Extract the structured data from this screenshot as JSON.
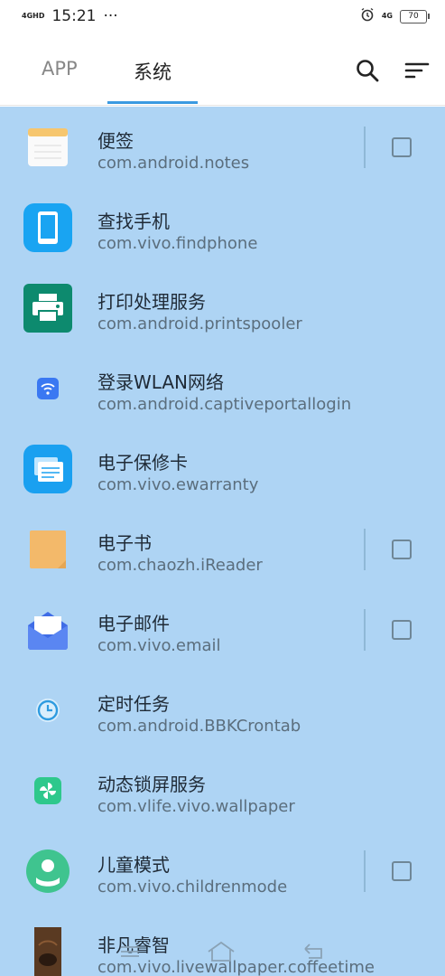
{
  "status": {
    "network_tag": "4GHD",
    "time": "15:21",
    "more": "···",
    "net_right": "4G",
    "battery": "70"
  },
  "tabs": [
    {
      "label": "APP",
      "active": false
    },
    {
      "label": "系统",
      "active": true
    }
  ],
  "apps": [
    {
      "name": "便签",
      "package": "com.android.notes",
      "icon": "notes-icon",
      "checkbox": true,
      "color": "#f6c66e"
    },
    {
      "name": "查找手机",
      "package": "com.vivo.findphone",
      "icon": "findphone-icon",
      "checkbox": false,
      "color": "#19a4f2"
    },
    {
      "name": "打印处理服务",
      "package": "com.android.printspooler",
      "icon": "printer-icon",
      "checkbox": false,
      "color": "#0d8a6e"
    },
    {
      "name": "登录WLAN网络",
      "package": "com.android.captiveportallogin",
      "icon": "wifi-icon",
      "checkbox": false,
      "color": "#3a78f2"
    },
    {
      "name": "电子保修卡",
      "package": "com.vivo.ewarranty",
      "icon": "warranty-card-icon",
      "checkbox": false,
      "color": "#1aa0f0"
    },
    {
      "name": "电子书",
      "package": "com.chaozh.iReader",
      "icon": "ebook-icon",
      "checkbox": true,
      "color": "#f3b96a"
    },
    {
      "name": "电子邮件",
      "package": "com.vivo.email",
      "icon": "email-icon",
      "checkbox": true,
      "color": "#3f6ce6"
    },
    {
      "name": "定时任务",
      "package": "com.android.BBKCrontab",
      "icon": "clock-icon",
      "checkbox": false,
      "color": "#2e9be0"
    },
    {
      "name": "动态锁屏服务",
      "package": "com.vlife.vivo.wallpaper",
      "icon": "pinwheel-icon",
      "checkbox": false,
      "color": "#2ec88c"
    },
    {
      "name": "儿童模式",
      "package": "com.vivo.childrenmode",
      "icon": "child-icon",
      "checkbox": true,
      "color": "#3fc48f"
    },
    {
      "name": "非凡睿智",
      "package": "com.vivo.livewallpaper.coffeetime",
      "icon": "coffee-wallpaper-icon",
      "checkbox": false,
      "color": "#5a3a22"
    }
  ]
}
